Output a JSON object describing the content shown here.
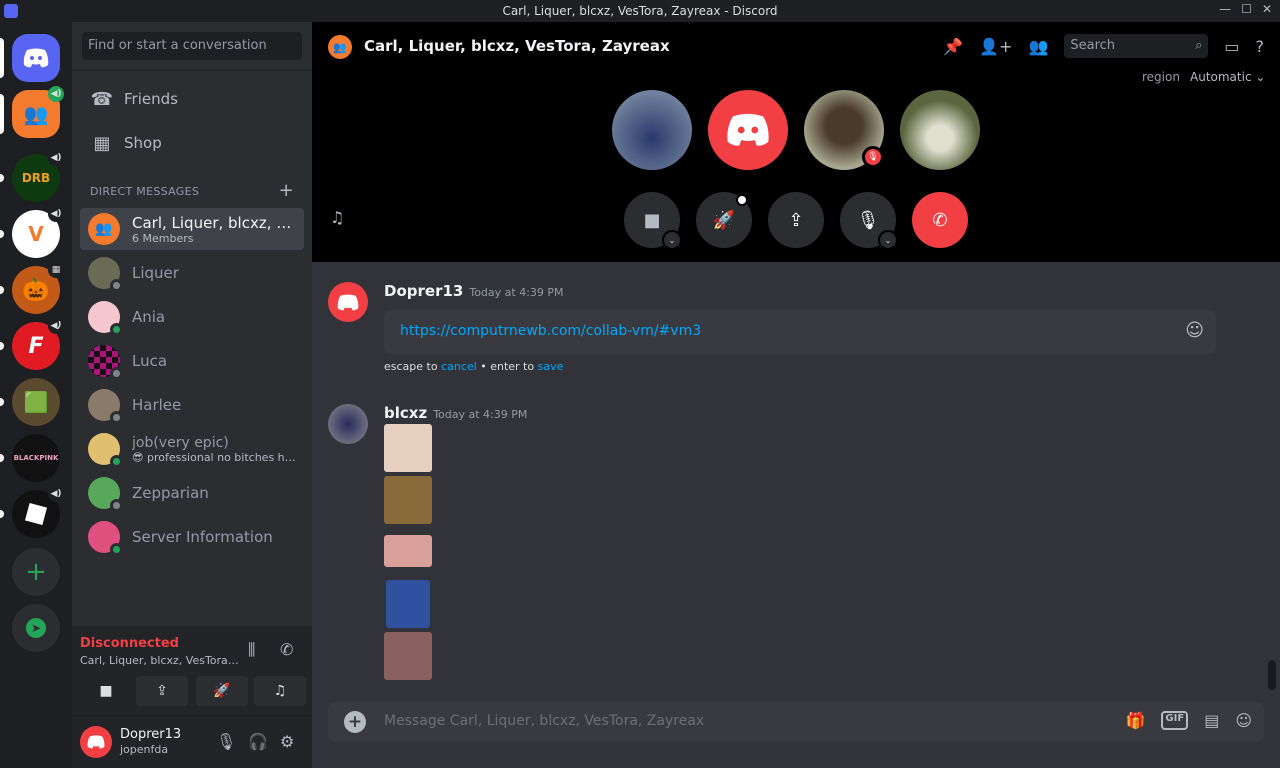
{
  "window": {
    "title": "Carl, Liquer, blcxz, VesTora, Zayreax - Discord",
    "controls": [
      "—",
      "☐",
      "✕"
    ]
  },
  "servers": [
    {
      "name": "home",
      "label": "",
      "color": "#5865f2"
    },
    {
      "name": "group-dm",
      "label": "",
      "color": "#f47b2e"
    },
    {
      "name": "drb",
      "label": "DRB",
      "color": "#0e3a10"
    },
    {
      "name": "valorant-v",
      "label": "V",
      "color": "#ffffff"
    },
    {
      "name": "pumpkin",
      "label": "",
      "color": "#c45a17"
    },
    {
      "name": "f-server",
      "label": "F",
      "color": "#e01b24"
    },
    {
      "name": "minecraft",
      "label": "",
      "color": "#5a4a2e"
    },
    {
      "name": "blackpink",
      "label": "BLACKPINK",
      "color": "#111111"
    },
    {
      "name": "roblox",
      "label": "",
      "color": "#111111"
    }
  ],
  "dm_sidebar": {
    "search_placeholder": "Find or start a conversation",
    "friends_label": "Friends",
    "shop_label": "Shop",
    "section_title": "DIRECT MESSAGES",
    "add_label": "+",
    "items": [
      {
        "name": "Carl, Liquer, blcxz, Ve...",
        "sub": "6 Members",
        "color": "#f47b2e",
        "status": "none",
        "active": true
      },
      {
        "name": "Liquer",
        "sub": "",
        "color": "#6b6b55",
        "status": "offline"
      },
      {
        "name": "Ania",
        "sub": "",
        "color": "#f5c6d0",
        "status": "online"
      },
      {
        "name": "Luca",
        "sub": "",
        "color": "#b0127d",
        "status": "offline"
      },
      {
        "name": "Harlee",
        "sub": "",
        "color": "#8a7a6a",
        "status": "offline"
      },
      {
        "name": "job(very epic)",
        "sub": "😎 professional no bitches ha...",
        "color": "#e0c070",
        "status": "online"
      },
      {
        "name": "Zepparian",
        "sub": "",
        "color": "#57a85a",
        "status": "offline"
      },
      {
        "name": "Server Information",
        "sub": "",
        "color": "#e0507f",
        "status": "online"
      }
    ]
  },
  "voice_panel": {
    "status": "Disconnected",
    "channel": "Carl, Liquer, blcxz, VesTora, ..."
  },
  "user_panel": {
    "username": "Doprer13",
    "tag": "jopenfda"
  },
  "header": {
    "title": "Carl, Liquer, blcxz, VesTora, Zayreax",
    "search_placeholder": "Search",
    "region_label": "region",
    "region_value": "Automatic ⌄"
  },
  "call": {
    "participants": [
      {
        "name": "participant-1",
        "color": "#4a5a7a",
        "muted": false
      },
      {
        "name": "participant-2",
        "color": "#f23f43",
        "muted": false
      },
      {
        "name": "participant-3",
        "color": "#6d6a52",
        "muted": true
      },
      {
        "name": "participant-4",
        "color": "#5b6640",
        "muted": false
      }
    ]
  },
  "messages": {
    "m1": {
      "author": "Doprer13",
      "time": "Today at 4:39 PM",
      "edit_value": "https://computrnewb.com/collab-vm/#vm3",
      "hint_prefix": "escape to ",
      "hint_cancel": "cancel",
      "hint_mid": " • enter to ",
      "hint_save": "save"
    },
    "m2": {
      "author": "blcxz",
      "time": "Today at 4:39 PM",
      "images": [
        {
          "color": "#e8d0c0"
        },
        {
          "color": "#8a6a3a"
        },
        {
          "color": "#d8a098"
        },
        {
          "color": "#3050a0"
        },
        {
          "color": "#8a6060"
        }
      ]
    }
  },
  "composer": {
    "placeholder": "Message Carl, Liquer, blcxz, VesTora, Zayreax",
    "gif_label": "GIF"
  }
}
